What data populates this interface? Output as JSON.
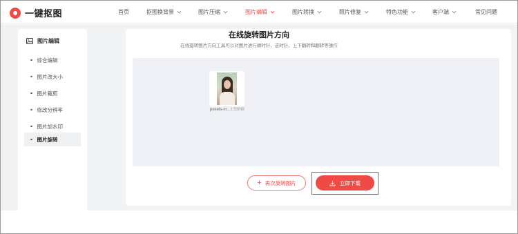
{
  "brand": {
    "name": "一键抠图"
  },
  "nav": {
    "items": [
      {
        "label": "首页",
        "has_dropdown": false,
        "active": false
      },
      {
        "label": "抠图换背景",
        "has_dropdown": true,
        "active": false
      },
      {
        "label": "图片压缩",
        "has_dropdown": true,
        "active": false
      },
      {
        "label": "图片编辑",
        "has_dropdown": true,
        "active": true
      },
      {
        "label": "图片转换",
        "has_dropdown": true,
        "active": false
      },
      {
        "label": "照片修复",
        "has_dropdown": true,
        "active": false
      },
      {
        "label": "特色功能",
        "has_dropdown": true,
        "active": false
      },
      {
        "label": "客户端",
        "has_dropdown": true,
        "active": false
      },
      {
        "label": "常见问题",
        "has_dropdown": false,
        "active": false
      }
    ]
  },
  "sidebar": {
    "title": "图片编辑",
    "title_icon": "image-edit-icon",
    "items": [
      {
        "label": "综合编辑",
        "active": false
      },
      {
        "label": "图片改大小",
        "active": false
      },
      {
        "label": "图片裁剪",
        "active": false
      },
      {
        "label": "修改分辨率",
        "active": false
      },
      {
        "label": "图片加水印",
        "active": false
      },
      {
        "label": "图片旋转",
        "active": true
      }
    ]
  },
  "main": {
    "title": "在线旋转图片方向",
    "subtitle": "在线旋转图片方向工具可以对图片进行顺时针、逆时针、上下翻转和翻转等操作"
  },
  "file": {
    "name": "pexels-m...",
    "size": "1.53MB"
  },
  "actions": {
    "rotate_again": "再次旋转图片",
    "download": "立即下载"
  },
  "colors": {
    "accent": "#ee4b46",
    "page_bg": "#f2f3f5",
    "canvas_bg": "#eff1f6"
  }
}
